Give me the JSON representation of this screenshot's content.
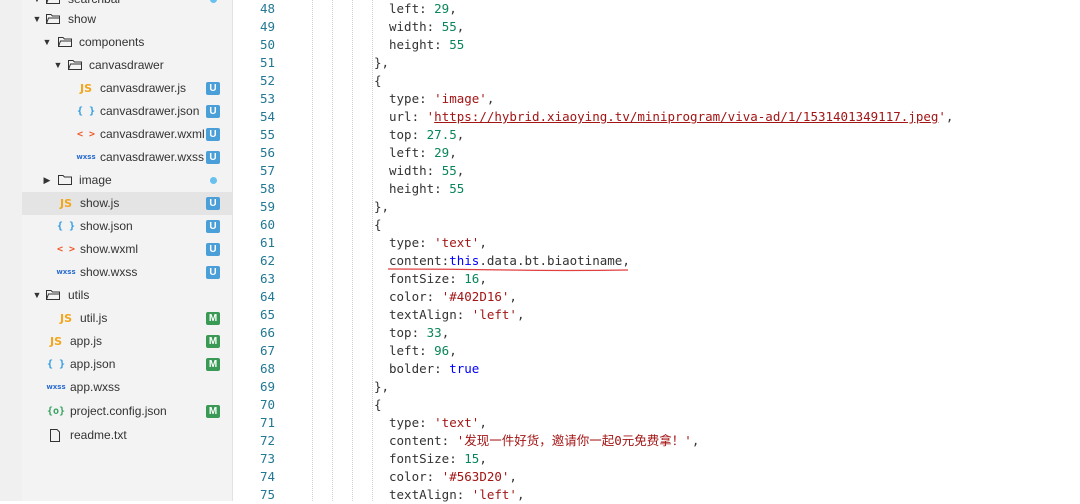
{
  "sidebar": {
    "rows": [
      {
        "id": "top",
        "type": "folder",
        "label": "searchbar",
        "depth": 0,
        "expanded": true,
        "dot": true
      },
      {
        "id": "show",
        "type": "folder",
        "label": "show",
        "depth": 0,
        "expanded": true
      },
      {
        "id": "components",
        "type": "folder",
        "label": "components",
        "depth": 1,
        "expanded": true
      },
      {
        "id": "canvasdrawer",
        "type": "folder",
        "label": "canvasdrawer",
        "depth": 2,
        "expanded": true
      },
      {
        "id": "cd-js",
        "type": "file",
        "icon": "JS",
        "label": "canvasdrawer.js",
        "badge": "U"
      },
      {
        "id": "cd-json",
        "type": "file",
        "icon": "{ }",
        "label": "canvasdrawer.json",
        "badge": "U"
      },
      {
        "id": "cd-wxml",
        "type": "file",
        "icon": "< >",
        "label": "canvasdrawer.wxml",
        "badge": "U"
      },
      {
        "id": "cd-wxss",
        "type": "file",
        "icon": "wxss",
        "label": "canvasdrawer.wxss",
        "badge": "U"
      },
      {
        "id": "image",
        "type": "folder",
        "label": "image",
        "expanded": false,
        "dot": true
      },
      {
        "id": "show-js",
        "type": "file",
        "icon": "JS",
        "label": "show.js",
        "badge": "U",
        "selected": true
      },
      {
        "id": "show-json",
        "type": "file",
        "icon": "{ }",
        "label": "show.json",
        "badge": "U"
      },
      {
        "id": "show-wxml",
        "type": "file",
        "icon": "< >",
        "label": "show.wxml",
        "badge": "U"
      },
      {
        "id": "show-wxss",
        "type": "file",
        "icon": "wxss",
        "label": "show.wxss",
        "badge": "U"
      },
      {
        "id": "utils",
        "type": "folder",
        "label": "utils",
        "expanded": true
      },
      {
        "id": "util-js",
        "type": "file",
        "icon": "JS",
        "label": "util.js",
        "badge": "M"
      },
      {
        "id": "app-js",
        "type": "file",
        "icon": "JS",
        "label": "app.js",
        "badge": "M"
      },
      {
        "id": "app-json",
        "type": "file",
        "icon": "{ }",
        "label": "app.json",
        "badge": "M"
      },
      {
        "id": "app-wxss",
        "type": "file",
        "icon": "wxss",
        "label": "app.wxss"
      },
      {
        "id": "project-config",
        "type": "file",
        "icon": "{o}",
        "label": "project.config.json",
        "badge": "M"
      },
      {
        "id": "readme",
        "type": "file",
        "icon": "doc",
        "label": "readme.txt"
      }
    ]
  },
  "editor": {
    "lines": [
      {
        "n": "48",
        "t": "left: 29,"
      },
      {
        "n": "49",
        "t": "width: 55,"
      },
      {
        "n": "50",
        "t": "height: 55"
      },
      {
        "n": "51",
        "t": "},"
      },
      {
        "n": "52",
        "t": "{"
      },
      {
        "n": "53",
        "t": "type: 'image',"
      },
      {
        "n": "54",
        "t": "url: 'https://hybrid.xiaoying.tv/miniprogram/viva-ad/1/1531401349117.jpeg',"
      },
      {
        "n": "55",
        "t": "top: 27.5,"
      },
      {
        "n": "56",
        "t": "left: 29,"
      },
      {
        "n": "57",
        "t": "width: 55,"
      },
      {
        "n": "58",
        "t": "height: 55"
      },
      {
        "n": "59",
        "t": "},"
      },
      {
        "n": "60",
        "t": "{"
      },
      {
        "n": "61",
        "t": "type: 'text',"
      },
      {
        "n": "62",
        "t": "content:this.data.bt.biaotiname,"
      },
      {
        "n": "63",
        "t": "fontSize: 16,"
      },
      {
        "n": "64",
        "t": "color: '#402D16',"
      },
      {
        "n": "65",
        "t": "textAlign: 'left',"
      },
      {
        "n": "66",
        "t": "top: 33,"
      },
      {
        "n": "67",
        "t": "left: 96,"
      },
      {
        "n": "68",
        "t": "bolder: true"
      },
      {
        "n": "69",
        "t": "},"
      },
      {
        "n": "70",
        "t": "{"
      },
      {
        "n": "71",
        "t": "type: 'text',"
      },
      {
        "n": "72",
        "t": "content: '发现一件好货，邀请你一起0元免费拿！',"
      },
      {
        "n": "73",
        "t": "fontSize: 15,"
      },
      {
        "n": "74",
        "t": "color: '#563D20',"
      },
      {
        "n": "75",
        "t": "textAlign: 'left',"
      }
    ]
  },
  "colors": {
    "badge_untracked": "#4a9fd8",
    "badge_modified": "#3a9a55",
    "string": "#a31515",
    "number": "#098658",
    "keyword": "#0000ff",
    "line_number": "#237893"
  }
}
